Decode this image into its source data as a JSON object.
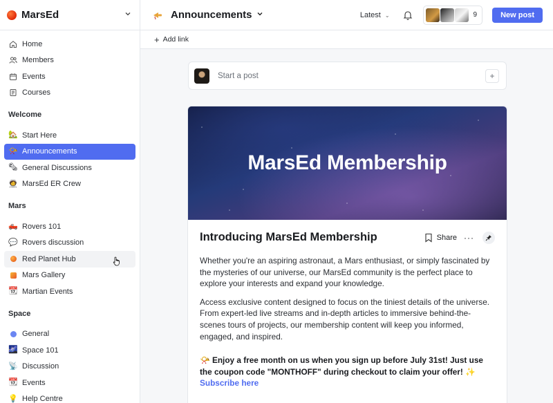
{
  "brand": {
    "name": "MarsEd"
  },
  "sidebar": {
    "top_items": [
      {
        "label": "Home",
        "icon": "home-icon"
      },
      {
        "label": "Members",
        "icon": "members-icon"
      },
      {
        "label": "Events",
        "icon": "calendar-icon"
      },
      {
        "label": "Courses",
        "icon": "courses-icon"
      }
    ],
    "sections": [
      {
        "title": "Welcome",
        "items": [
          {
            "label": "Start Here",
            "icon": "start-here-emoji",
            "glyph": "🏡"
          },
          {
            "label": "Announcements",
            "icon": "trumpet-emoji",
            "glyph": "📯",
            "active": true
          },
          {
            "label": "General Discussions",
            "icon": "newspaper-emoji",
            "glyph": "🗞"
          },
          {
            "label": "MarsEd ER Crew",
            "icon": "astronaut-emoji",
            "glyph": "🧑‍🚀"
          }
        ]
      },
      {
        "title": "Mars",
        "items": [
          {
            "label": "Rovers 101",
            "icon": "rover-emoji",
            "glyph": "🛻"
          },
          {
            "label": "Rovers discussion",
            "icon": "speech-bubble-emoji",
            "glyph": "💬"
          },
          {
            "label": "Red Planet Hub",
            "icon": "red-planet-dot",
            "hover": true
          },
          {
            "label": "Mars Gallery",
            "icon": "gallery-square"
          },
          {
            "label": "Martian Events",
            "icon": "calendar-emoji",
            "glyph": "📆"
          }
        ]
      },
      {
        "title": "Space",
        "items": [
          {
            "label": "General",
            "icon": "blue-dot"
          },
          {
            "label": "Space 101",
            "icon": "galaxy-emoji",
            "glyph": "🌌"
          },
          {
            "label": "Discussion",
            "icon": "satellite-emoji",
            "glyph": "📡"
          },
          {
            "label": "Events",
            "icon": "calendar-emoji",
            "glyph": "📆"
          },
          {
            "label": "Help Centre",
            "icon": "lightbulb-emoji",
            "glyph": "💡"
          }
        ]
      }
    ]
  },
  "header": {
    "title": "Announcements",
    "sort_label": "Latest",
    "member_count": "9",
    "new_post_label": "New post"
  },
  "subbar": {
    "add_link_label": "Add link"
  },
  "composer": {
    "placeholder": "Start a post"
  },
  "post": {
    "banner_title": "MarsEd Membership",
    "title": "Introducing MarsEd Membership",
    "share_label": "Share",
    "paragraph_1": "Whether you're an aspiring astronaut, a Mars enthusiast, or simply fascinated by the mysteries of our universe, our MarsEd community is the perfect place to explore your interests and expand your knowledge.",
    "paragraph_2": "Access exclusive content designed to focus on the tiniest details of the universe. From expert-led live streams and in-depth articles to immersive behind-the-scenes tours of projects, our membership content will keep you informed, engaged, and inspired.",
    "promo_text": "📯 Enjoy a free month on us when you sign up before July 31st! Just use the coupon code \"MONTHOFF\" during checkout to claim your offer! ✨ ",
    "promo_link": "Subscribe here"
  },
  "colors": {
    "accent": "#506cf0",
    "border": "#e4e7eb",
    "background": "#f6f7f9"
  }
}
